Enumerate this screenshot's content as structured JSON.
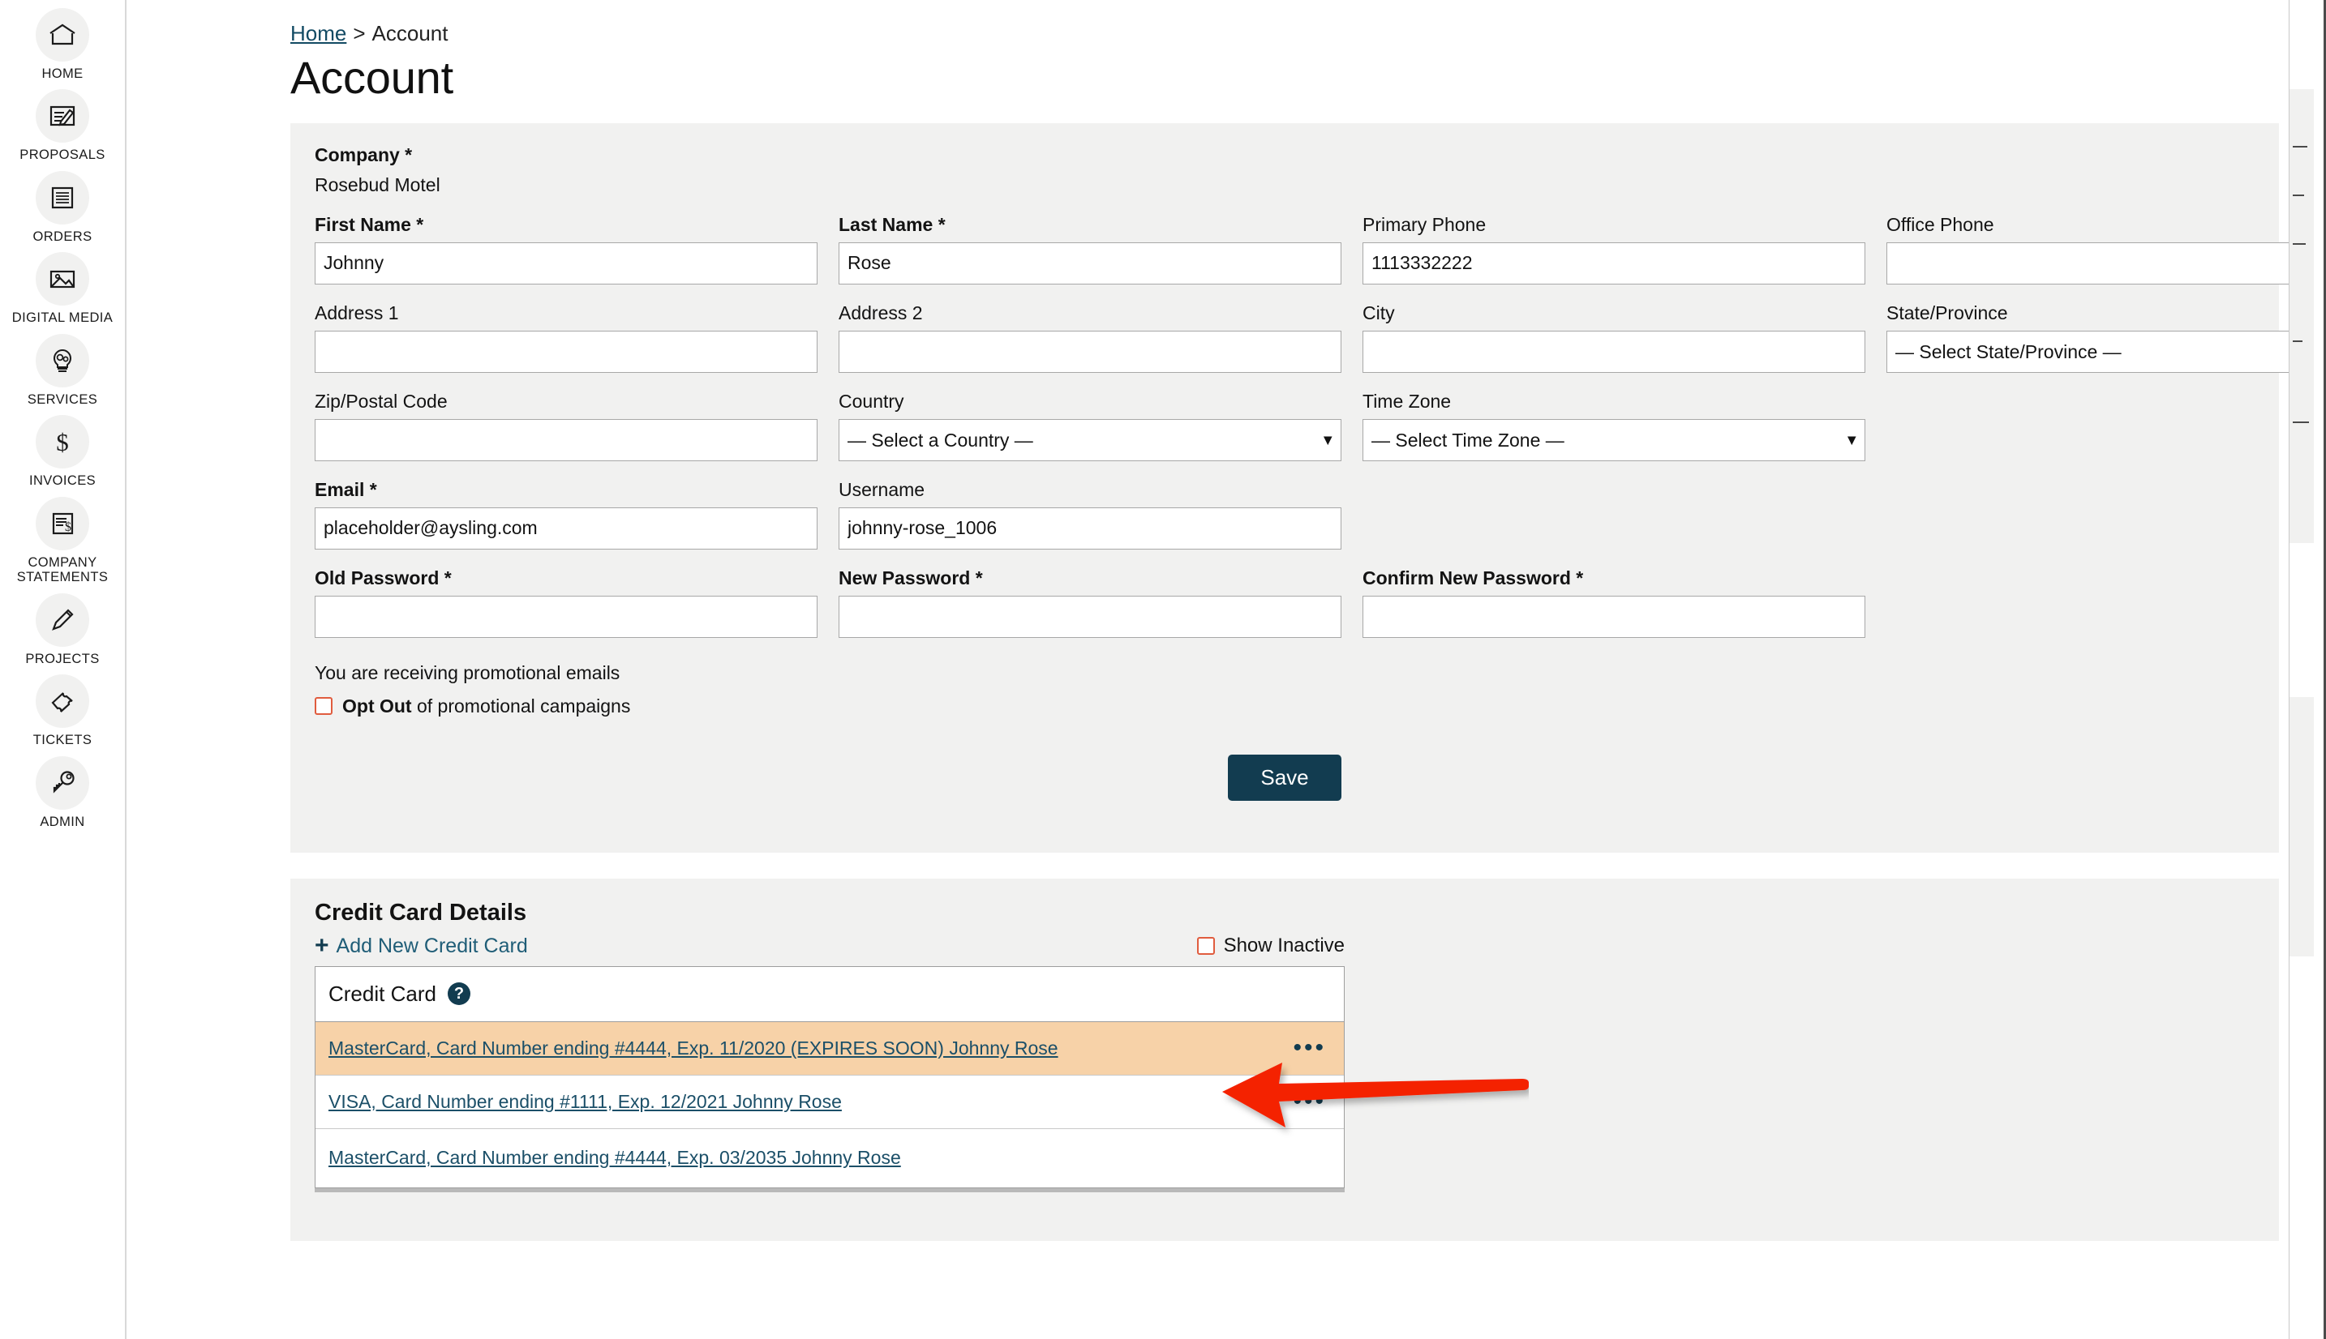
{
  "sidebar": {
    "items": [
      {
        "label": "HOME",
        "icon": "home-icon"
      },
      {
        "label": "PROPOSALS",
        "icon": "proposal-icon"
      },
      {
        "label": "ORDERS",
        "icon": "orders-icon"
      },
      {
        "label": "DIGITAL MEDIA",
        "icon": "image-icon"
      },
      {
        "label": "SERVICES",
        "icon": "lightbulb-gear-icon"
      },
      {
        "label": "INVOICES",
        "icon": "dollar-icon"
      },
      {
        "label": "COMPANY STATEMENTS",
        "icon": "statement-icon"
      },
      {
        "label": "PROJECTS",
        "icon": "pencil-icon"
      },
      {
        "label": "TICKETS",
        "icon": "ticket-icon"
      },
      {
        "label": "ADMIN",
        "icon": "key-icon"
      }
    ]
  },
  "breadcrumb": {
    "home": "Home",
    "separator": ">",
    "current": "Account"
  },
  "page": {
    "title": "Account"
  },
  "account": {
    "company_label": "Company *",
    "company_value": "Rosebud Motel",
    "fields": {
      "first_name": {
        "label": "First Name *",
        "value": "Johnny"
      },
      "last_name": {
        "label": "Last Name *",
        "value": "Rose"
      },
      "primary_phone": {
        "label": "Primary Phone",
        "value": "1113332222"
      },
      "office_phone": {
        "label": "Office Phone",
        "value": ""
      },
      "address1": {
        "label": "Address 1",
        "value": ""
      },
      "address2": {
        "label": "Address 2",
        "value": ""
      },
      "city": {
        "label": "City",
        "value": ""
      },
      "state": {
        "label": "State/Province",
        "value": "— Select State/Province —"
      },
      "zip": {
        "label": "Zip/Postal Code",
        "value": ""
      },
      "country": {
        "label": "Country",
        "value": "— Select a Country —"
      },
      "timezone": {
        "label": "Time Zone",
        "value": "— Select Time Zone —"
      },
      "email": {
        "label": "Email *",
        "value": "placeholder@aysling.com"
      },
      "username": {
        "label": "Username",
        "value": "johnny-rose_1006"
      },
      "old_password": {
        "label": "Old Password *",
        "value": ""
      },
      "new_password": {
        "label": "New Password *",
        "value": ""
      },
      "confirm_new_password": {
        "label": "Confirm New Password *",
        "value": ""
      }
    },
    "promo": {
      "status_text": "You are receiving promotional emails",
      "optout_bold": "Opt Out",
      "optout_rest": " of promotional campaigns",
      "checked": false
    },
    "save_label": "Save"
  },
  "credit_cards": {
    "section_title": "Credit Card Details",
    "add_label": "Add New Credit Card",
    "add_icon": "plus-icon",
    "show_inactive_label": "Show Inactive",
    "show_inactive_checked": false,
    "column_header": "Credit Card",
    "help_icon": "question-mark-icon",
    "rows": [
      {
        "text": "MasterCard, Card Number ending #4444, Exp. 11/2020 (EXPIRES SOON) Johnny Rose",
        "highlighted": true,
        "has_menu": true,
        "menu_icon": "ellipsis-icon"
      },
      {
        "text": "VISA, Card Number ending #1111, Exp. 12/2021 Johnny Rose",
        "highlighted": false,
        "has_menu": true,
        "menu_icon": "ellipsis-icon"
      },
      {
        "text": "MasterCard, Card Number ending #4444, Exp. 03/2035 Johnny Rose",
        "highlighted": false,
        "has_menu": false,
        "menu_icon": ""
      }
    ]
  },
  "annotation": {
    "arrow_icon": "red-left-arrow",
    "color": "#f42000"
  },
  "colors": {
    "accent_dark": "#123c50",
    "link": "#1b4f68",
    "panel_bg": "#f1f1f0",
    "highlight_row": "#f7d2a8",
    "checkbox_border": "#e05c3e",
    "arrow_red": "#f42000"
  }
}
